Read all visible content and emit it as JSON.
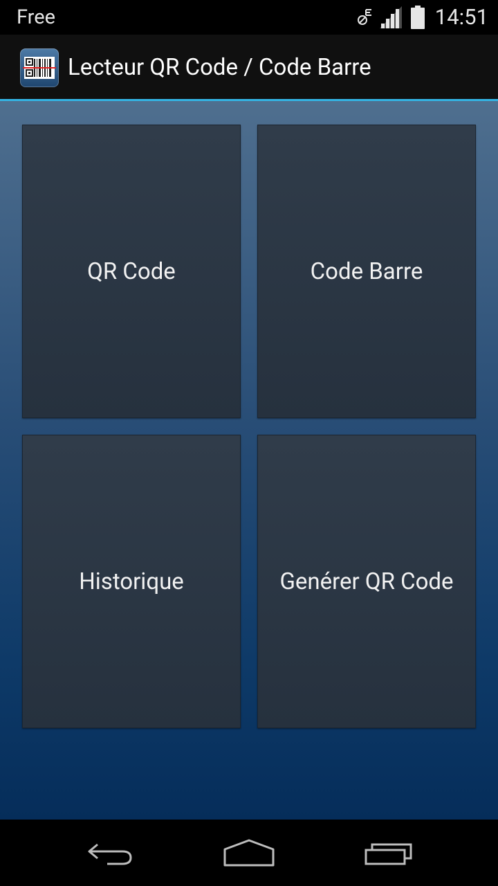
{
  "status_bar": {
    "carrier": "Free",
    "time": "14:51",
    "icons": [
      "nfc-icon",
      "signal-icon",
      "battery-icon"
    ]
  },
  "action_bar": {
    "title": "Lecteur QR Code / Code Barre",
    "icon": "qr-barcode-app-icon"
  },
  "tiles": [
    {
      "label": "QR Code"
    },
    {
      "label": "Code Barre"
    },
    {
      "label": "Historique"
    },
    {
      "label": "Genérer QR Code"
    }
  ],
  "nav_bar": {
    "icons": [
      "back-icon",
      "home-icon",
      "recents-icon"
    ]
  },
  "colors": {
    "accent": "#33b5e5",
    "tile": "#2a3542",
    "background_top": "#4f6f8f",
    "background_bottom": "#052d5a"
  }
}
